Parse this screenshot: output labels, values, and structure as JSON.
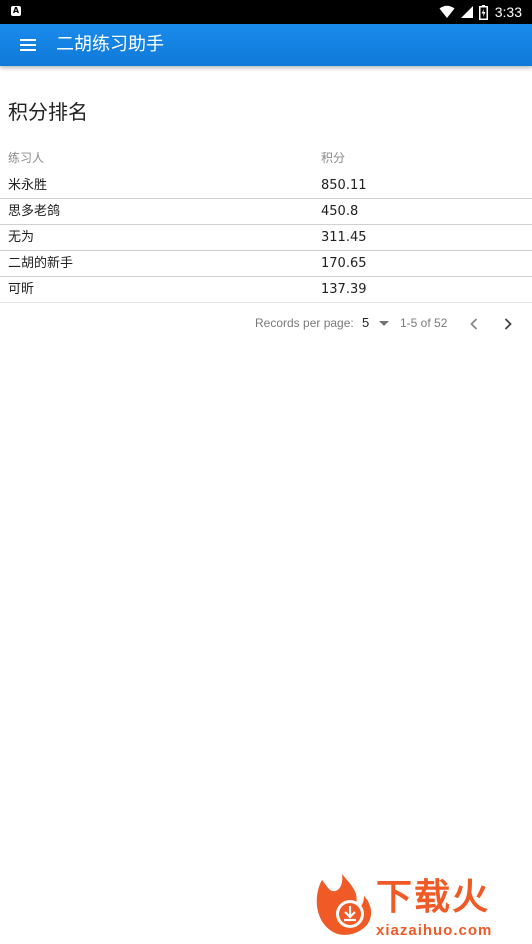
{
  "status_bar": {
    "app_icon_letter": "A",
    "time": "3:33",
    "icons": [
      "wifi-icon",
      "signal-icon",
      "battery-icon"
    ]
  },
  "app_bar": {
    "title": "二胡练习助手",
    "menu_icon": "menu-icon",
    "color": "#1a8bec"
  },
  "page": {
    "heading": "积分排名"
  },
  "table": {
    "headers": {
      "name": "练习人",
      "score": "积分"
    },
    "rows": [
      {
        "name": "米永胜",
        "score": "850.11"
      },
      {
        "name": "思多老鸽",
        "score": "450.8"
      },
      {
        "name": "无为",
        "score": "311.45"
      },
      {
        "name": "二胡的新手",
        "score": "170.65"
      },
      {
        "name": "可昕",
        "score": "137.39"
      }
    ]
  },
  "pagination": {
    "records_per_page_label": "Records per page:",
    "records_per_page_value": "5",
    "range": "1-5 of 52"
  },
  "watermark": {
    "brand": "下载火",
    "url": "xiazaihuo.com",
    "color": "#ef5a26"
  }
}
